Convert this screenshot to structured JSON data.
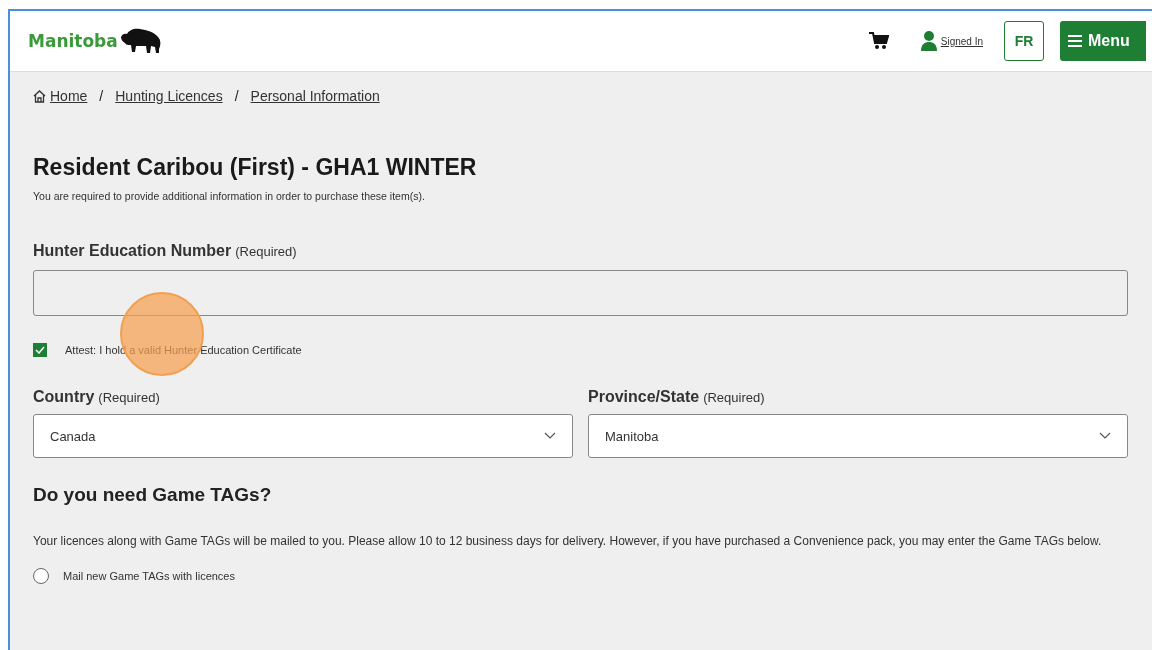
{
  "header": {
    "logo": "Manitoba",
    "account": "Signed In",
    "language": "FR",
    "menu": "Menu"
  },
  "breadcrumb": [
    "Home",
    "Hunting Licences",
    "Personal Information"
  ],
  "breadcrumb_separator": "/",
  "title": "Resident Caribou (First) - GHA1 WINTER",
  "intro": "You are required to provide additional information in order to purchase these item(s).",
  "hunter_education": {
    "label": "Hunter Education Number",
    "required": "(Required)"
  },
  "attest": {
    "label": "Attest: I hold a valid Hunter Education Certificate",
    "checked": true
  },
  "selects": [
    {
      "label": "Country",
      "required": "(Required)",
      "value": "Canada"
    },
    {
      "label": "Province/State",
      "required": "(Required)",
      "value": "Manitoba"
    }
  ],
  "game_tags": {
    "heading": "Do you need Game TAGs?",
    "text": "Your licences along with Game TAGs will be mailed to you. Please allow 10 to 12 business days for delivery. However, if you have purchased a Convenience pack, you may enter the Game TAGs below.",
    "options": [
      {
        "label": "Mail new Game TAGs with licences",
        "selected": false
      }
    ]
  }
}
